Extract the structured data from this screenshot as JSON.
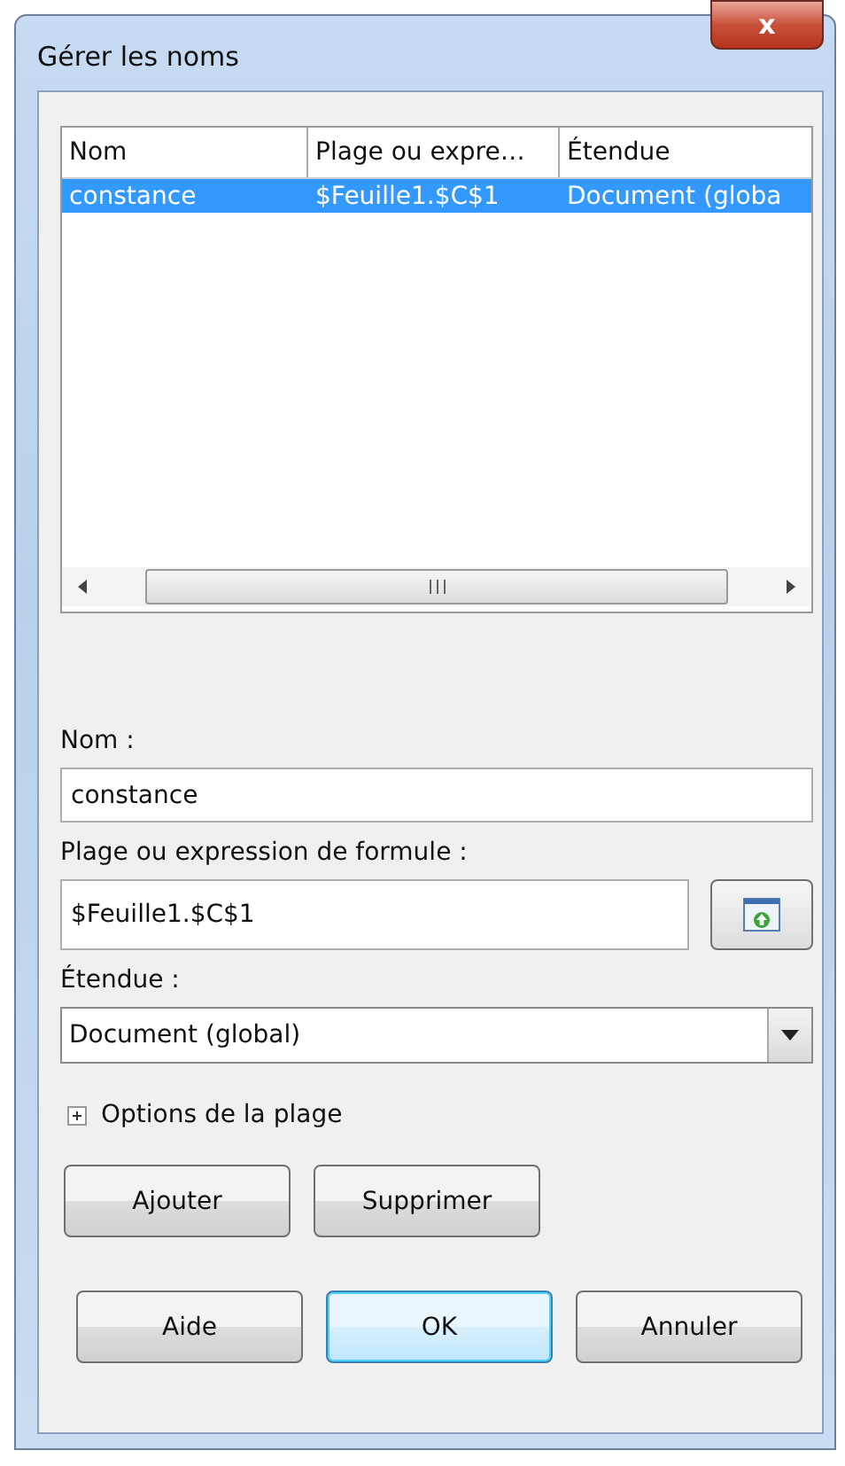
{
  "window": {
    "title": "Gérer les noms",
    "close_label": "x"
  },
  "names_table": {
    "columns": [
      "Nom",
      "Plage ou expre…",
      "Étendue"
    ],
    "rows": [
      {
        "cells": [
          "constance",
          "$Feuille1.$C$1",
          "Document (globa"
        ],
        "selected": true
      }
    ]
  },
  "fields": [
    {
      "kind": "text",
      "label": "Nom :",
      "value": "constance"
    },
    {
      "kind": "range",
      "label": "Plage ou expression de formule :",
      "value": "$Feuille1.$C$1"
    },
    {
      "kind": "dropdown",
      "label": "Étendue :",
      "value": "Document (global)"
    }
  ],
  "expander": {
    "label": "Options de la plage",
    "expanded": false
  },
  "action_buttons": [
    {
      "label": "Ajouter"
    },
    {
      "label": "Supprimer"
    }
  ],
  "dialog_buttons": [
    {
      "label": "Aide",
      "default": false
    },
    {
      "label": "OK",
      "default": true
    },
    {
      "label": "Annuler",
      "default": false
    }
  ]
}
